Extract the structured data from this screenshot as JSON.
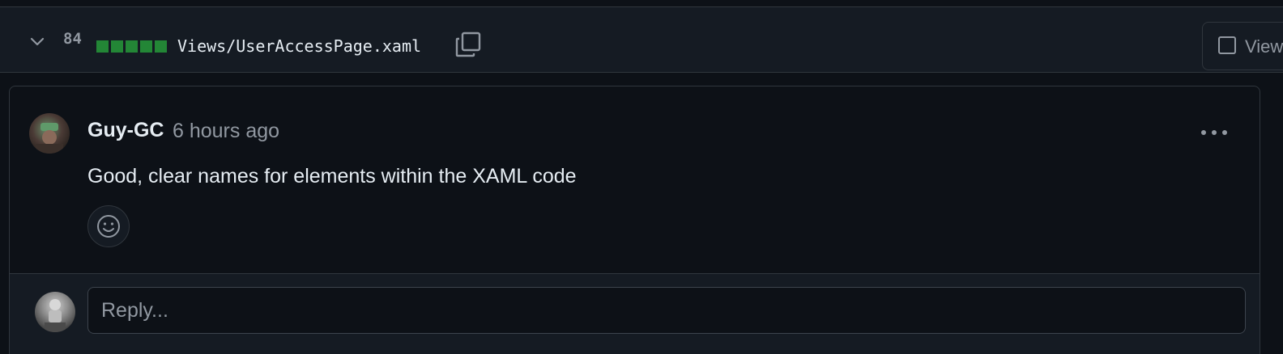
{
  "file_header": {
    "diff_count": "84",
    "file_path": "Views/UserAccessPage.xaml",
    "viewed_label": "Viewed",
    "diffstat_blocks": 5,
    "diffstat_color": "#238636"
  },
  "comment": {
    "author": "Guy-GC",
    "timestamp": "6 hours ago",
    "body": "Good, clear names for elements within the XAML code"
  },
  "reply": {
    "placeholder": "Reply..."
  },
  "colors": {
    "background": "#0d1117",
    "header_bg": "#151b23",
    "border": "#30363d",
    "muted_text": "#9198a1",
    "primary_text": "#e6edf3"
  },
  "icons": {
    "collapse": "chevron-down-icon",
    "copy": "copy-icon",
    "checkbox": "checkbox-icon",
    "more": "kebab-horizontal-icon",
    "reaction": "smiley-icon"
  }
}
